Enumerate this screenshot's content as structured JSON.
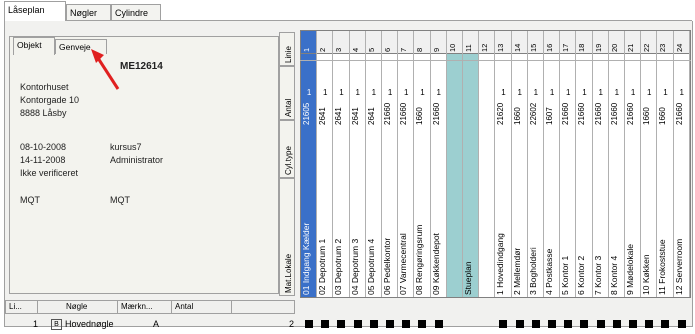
{
  "tabs": [
    "Låseplan",
    "Nøgler",
    "Cylindre"
  ],
  "subtabs": [
    "Objekt",
    "Genveje"
  ],
  "object": {
    "id": "ME12614",
    "address_lines": [
      "Kontorhuset",
      "Kontorgade 10",
      "8888 Låsby"
    ],
    "date1": "08-10-2008",
    "user1": "kursus7",
    "date2": "14-11-2008",
    "user2": "Administrator",
    "status": "Ikke verificeret",
    "code_a": "MQT",
    "code_b": "MQT"
  },
  "side_tabs": {
    "line": "Linie",
    "amount": "Antal",
    "cyl_type": "Cyl.type",
    "place": "Mat.Lokale"
  },
  "columns": [
    {
      "n": "1",
      "code": "21605",
      "name": "01 Indgang Kælder"
    },
    {
      "n": "2",
      "code": "2641",
      "name": "02 Depotrum 1"
    },
    {
      "n": "3",
      "code": "2641",
      "name": "03 Depotrum 2"
    },
    {
      "n": "4",
      "code": "2641",
      "name": "04 Depotrum 3"
    },
    {
      "n": "5",
      "code": "2641",
      "name": "05 Depotrum 4"
    },
    {
      "n": "6",
      "code": "21660",
      "name": "06 Pedelkontor"
    },
    {
      "n": "7",
      "code": "21660",
      "name": "07 Varmecentral"
    },
    {
      "n": "8",
      "code": "1660",
      "name": "08 Rengøringsrum"
    },
    {
      "n": "9",
      "code": "21660",
      "name": "09 Køkkendepot"
    },
    {
      "n": "10",
      "code": "",
      "name": ""
    },
    {
      "n": "11",
      "code": "",
      "name": "Stueplan"
    },
    {
      "n": "12",
      "code": "",
      "name": ""
    },
    {
      "n": "13",
      "code": "21620",
      "name": "1 Hovedindgang"
    },
    {
      "n": "14",
      "code": "1660",
      "name": "2 Mellemdør"
    },
    {
      "n": "15",
      "code": "22602",
      "name": "3 Bogholderi"
    },
    {
      "n": "16",
      "code": "1607",
      "name": "4 Postkasse"
    },
    {
      "n": "17",
      "code": "21660",
      "name": "5 Kontor 1"
    },
    {
      "n": "18",
      "code": "21660",
      "name": "6 Kontor 2"
    },
    {
      "n": "19",
      "code": "21660",
      "name": "7 Kontor 3"
    },
    {
      "n": "20",
      "code": "21660",
      "name": "8 Kontor 4"
    },
    {
      "n": "21",
      "code": "21660",
      "name": "9 Mødelokale"
    },
    {
      "n": "22",
      "code": "1660",
      "name": "10 Køkken"
    },
    {
      "n": "23",
      "code": "1660",
      "name": "11 Frokoststue"
    },
    {
      "n": "24",
      "code": "21660",
      "name": "12 Serverroom"
    }
  ],
  "one_value": "1",
  "key_headers": [
    "Li...",
    "Nøgle",
    "Mærkn...",
    "Antal"
  ],
  "key_row": {
    "line": "1",
    "flag": "B",
    "name": "Hovednøgle",
    "mark": "A",
    "amount": "2"
  },
  "colors": {
    "selected": "#3a70c8",
    "band": "#9ccfd0",
    "arrow": "#e02020"
  }
}
